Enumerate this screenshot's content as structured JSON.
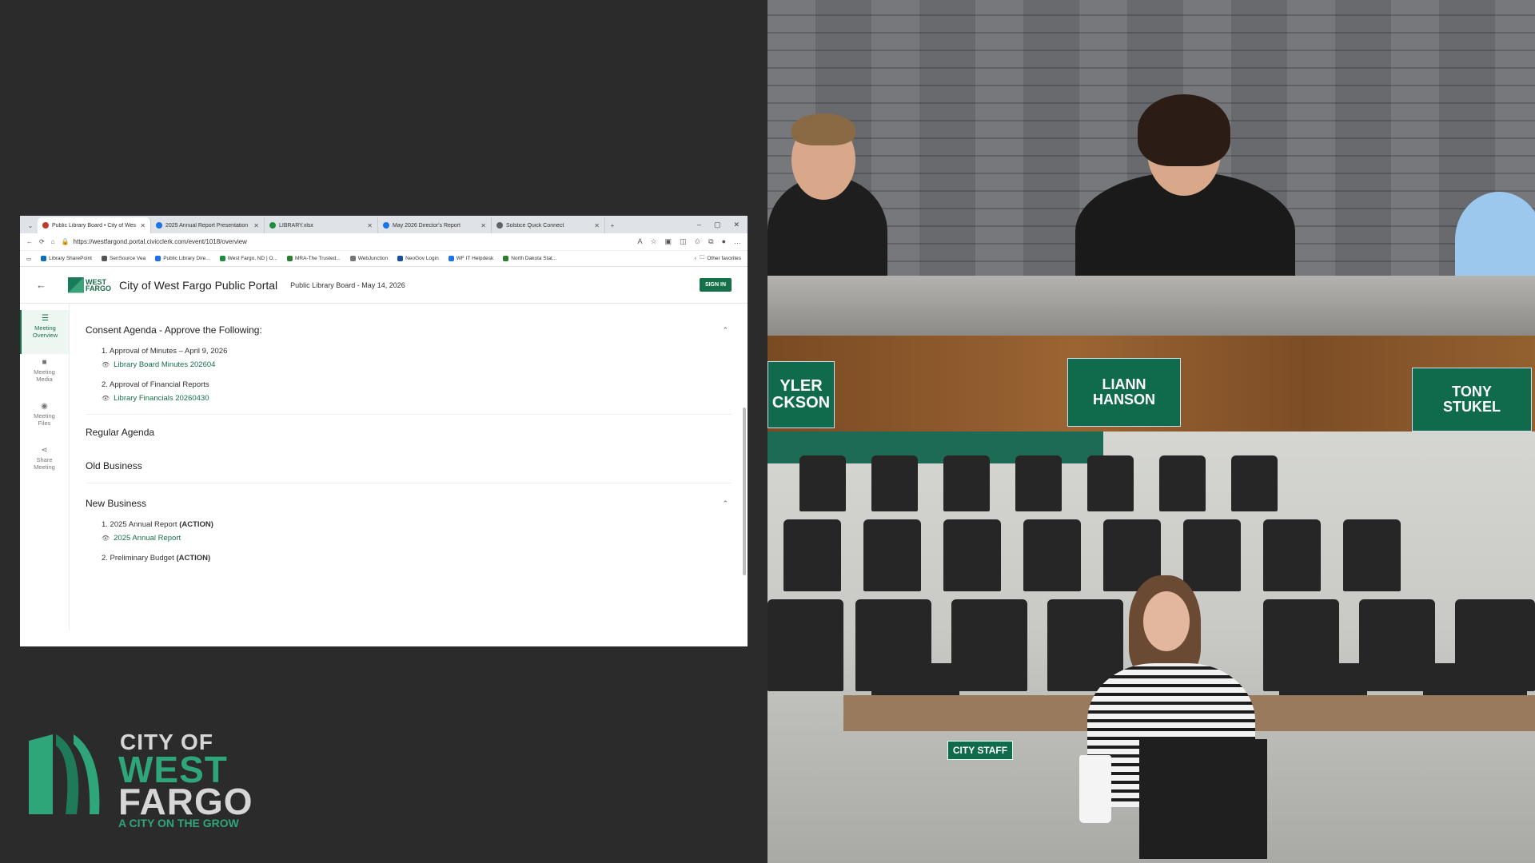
{
  "browser": {
    "tabs": [
      {
        "label": "Public Library Board • City of Wes",
        "color": "#c0392b",
        "active": true
      },
      {
        "label": "2025 Annual Report Presentation",
        "color": "#1a73e8",
        "active": false
      },
      {
        "label": "LIBRARY.xlsx",
        "color": "#1e8e3e",
        "active": false
      },
      {
        "label": "May 2026 Director's Report",
        "color": "#1a73e8",
        "active": false
      },
      {
        "label": "Solstice Quick Connect",
        "color": "#5f6368",
        "active": false
      }
    ],
    "url": "https://westfargond.portal.civicclerk.com/event/1018/overview",
    "favorites": [
      {
        "label": "Library SharePoint",
        "color": "#0b6fb8"
      },
      {
        "label": "SenSource Vea",
        "color": "#555555"
      },
      {
        "label": "Public Library Dire...",
        "color": "#1a73e8"
      },
      {
        "label": "West Fargo, ND | O...",
        "color": "#1e8e3e"
      },
      {
        "label": "MRA-The Trusted...",
        "color": "#2e7d32"
      },
      {
        "label": "WebJunction",
        "color": "#777777"
      },
      {
        "label": "NeoGov Login",
        "color": "#1a4fa0"
      },
      {
        "label": "WF IT Helpdesk",
        "color": "#1a73e8"
      },
      {
        "label": "North Dakota Stat...",
        "color": "#2e7d32"
      }
    ],
    "other_favorites": "Other favorites"
  },
  "portal": {
    "logo_line1": "WEST",
    "logo_line2": "FARGO",
    "title": "City of West Fargo Public Portal",
    "subtitle": "Public Library Board - May 14, 2026",
    "sign_in": "SIGN IN",
    "nav": [
      {
        "label1": "Meeting",
        "label2": "Overview",
        "icon": "list-icon"
      },
      {
        "label1": "Meeting",
        "label2": "Media",
        "icon": "video-icon"
      },
      {
        "label1": "Meeting",
        "label2": "Files",
        "icon": "file-icon"
      },
      {
        "label1": "Share",
        "label2": "Meeting",
        "icon": "share-icon"
      }
    ],
    "consent": {
      "heading": "Consent Agenda - Approve the Following:",
      "items": [
        {
          "title": "1. Approval of Minutes – April 9, 2026",
          "link": "Library Board Minutes 202604"
        },
        {
          "title": "2. Approval of Financial Reports",
          "link": "Library Financials 20260430"
        }
      ]
    },
    "regular_agenda": "Regular Agenda",
    "old_business": "Old Business",
    "new_business": {
      "heading": "New Business",
      "items": [
        {
          "title": "1. 2025 Annual Report",
          "tag": "(ACTION)",
          "link": "2025 Annual Report"
        },
        {
          "title": "2. Preliminary Budget",
          "tag": "(ACTION)"
        }
      ]
    }
  },
  "city_logo": {
    "line1": "CITY OF",
    "line2": "WEST",
    "line3": "FARGO",
    "tagline": "A CITY ON THE GROW"
  },
  "camera_top": {
    "nameplate_left": "YLER\nCKSON",
    "nameplate_center": "LIANN\nHANSON",
    "nameplate_right": "TONY\nSTUKEL"
  },
  "camera_bottom": {
    "staff_plate": "CITY STAFF"
  },
  "colors": {
    "brand_green": "#16704a",
    "logo_green": "#2fa57a",
    "nameplate_green": "#0f6b4b"
  }
}
